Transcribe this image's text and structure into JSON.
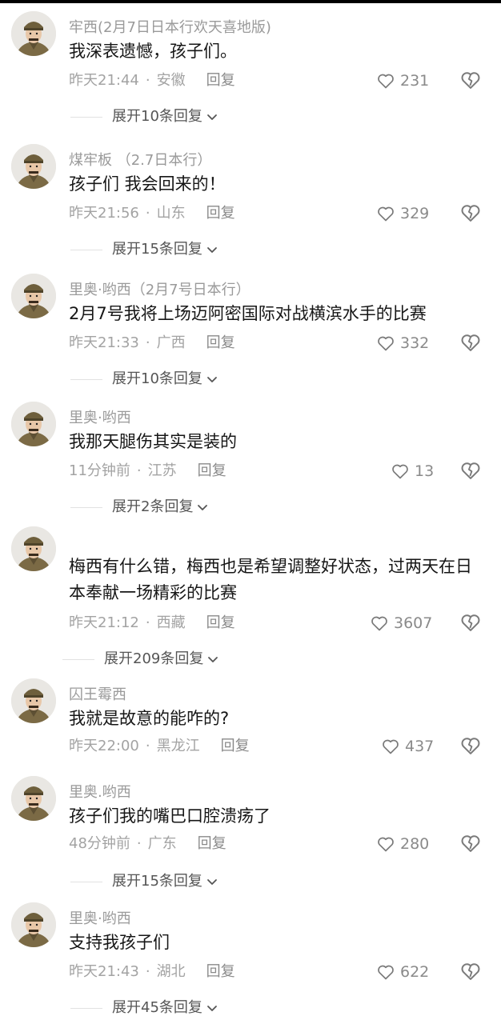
{
  "colors": {
    "username": "#9a9a9a",
    "content": "#161616",
    "meta": "#a3a3a3",
    "background": "#ffffff"
  },
  "icons": {
    "like": "heart-outline-icon",
    "dislike": "broken-heart-icon",
    "expand": "chevron-down-icon"
  },
  "comments": [
    {
      "username": "牢西(2月7日日本行欢天喜地版)",
      "content": "我深表遗憾，孩子们。",
      "time": "昨天21:44",
      "location": "安徽",
      "reply_label": "回复",
      "likes": "231",
      "expand_label": "展开10条回复"
    },
    {
      "username": "煤牢板 （2.7日本行）",
      "content": "孩子们 我会回来的！",
      "time": "昨天21:56",
      "location": "山东",
      "reply_label": "回复",
      "likes": "329",
      "expand_label": "展开15条回复"
    },
    {
      "username": "里奥·哟西（2月7号日本行）",
      "content": "2月7号我将上场迈阿密国际对战横滨水手的比赛",
      "time": "昨天21:33",
      "location": "广西",
      "reply_label": "回复",
      "likes": "332",
      "expand_label": "展开10条回复"
    },
    {
      "username": "里奥·哟西",
      "content": "我那天腿伤其实是装的",
      "time": "11分钟前",
      "location": "江苏",
      "reply_label": "回复",
      "likes": "13",
      "expand_label": "展开2条回复"
    },
    {
      "username": "",
      "content": "梅西有什么错，梅西也是希望调整好状态，过两天在日本奉献一场精彩的比赛",
      "time": "昨天21:12",
      "location": "西藏",
      "reply_label": "回复",
      "likes": "3607",
      "expand_label": "展开209条回复"
    },
    {
      "username": "囚王霉西",
      "content": "我就是故意的能咋的?",
      "time": "昨天22:00",
      "location": "黑龙江",
      "reply_label": "回复",
      "likes": "437",
      "expand_label": ""
    },
    {
      "username": "里奥.哟西",
      "content": "孩子们我的嘴巴口腔溃疡了",
      "time": "48分钟前",
      "location": "广东",
      "reply_label": "回复",
      "likes": "280",
      "expand_label": "展开15条回复"
    },
    {
      "username": "里奥·哟西",
      "content": "支持我孩子们",
      "time": "昨天21:43",
      "location": "湖北",
      "reply_label": "回复",
      "likes": "622",
      "expand_label": "展开45条回复"
    }
  ]
}
